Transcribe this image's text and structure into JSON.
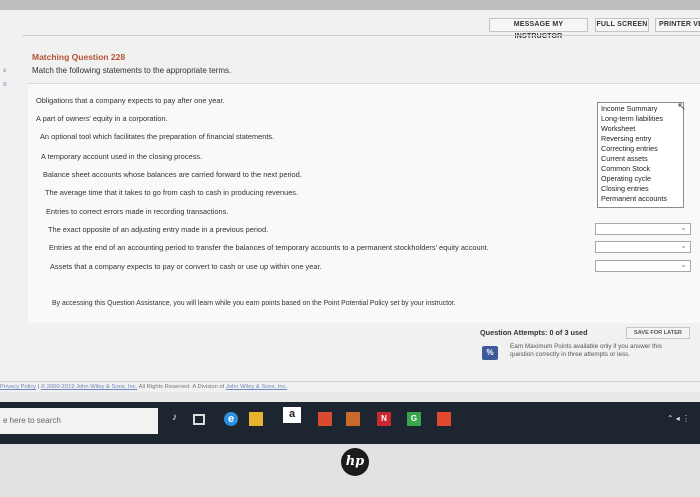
{
  "header": {
    "message_instructor": "MESSAGE MY INSTRUCTOR",
    "full_screen": "FULL SCREEN",
    "printer_version": "PRINTER VE"
  },
  "question": {
    "title": "Matching Question 228",
    "instruction": "Match the following statements to the appropriate terms."
  },
  "statements": [
    "Obligations that a company expects to pay after one year.",
    "A part of owners' equity in a corporation.",
    "An optional tool which facilitates the preparation of financial statements.",
    "A temporary account used in the closing process.",
    "Balance sheet accounts whose balances are carried forward to the next period.",
    "The average time that it takes to go from cash to cash in producing revenues.",
    "Entries to correct errors made in recording transactions.",
    "The exact opposite of an adjusting entry made in a previous period.",
    "Entries at the end of an accounting period to transfer the balances of temporary accounts to a permanent stockholders' equity account.",
    "Assets that a company expects to pay or convert to cash or use up within one year."
  ],
  "options": [
    "Income Summary",
    "Long-term liabilities",
    "Worksheet",
    "Reversing entry",
    "Correcting entries",
    "Current assets",
    "Common Stock",
    "Operating cycle",
    "Closing entries",
    "Permanent accounts"
  ],
  "policy_text": "By accessing this Question Assistance, you will learn while you earn points based on the Point Potential Policy set by your instructor.",
  "attempts": {
    "label": "Question Attempts: 0 of 3 used",
    "save_later": "SAVE FOR LATER",
    "earn_text": "Earn Maximum Points available only if you answer this question correctly in three attempts or less.",
    "icon_text": "%"
  },
  "footer": {
    "privacy": "Privacy Policy",
    "sep": "|",
    "copyright": "© 2000-2019 John Wiley & Sons, Inc.",
    "rights": "All Rights Reserved. A Division of",
    "division_link": "John Wiley & Sons, Inc."
  },
  "taskbar": {
    "search_placeholder": "e here to search",
    "amazon_letter": "a",
    "app1_letter": "N",
    "app2_letter": "G"
  },
  "brand": {
    "logo_text": "hp"
  }
}
